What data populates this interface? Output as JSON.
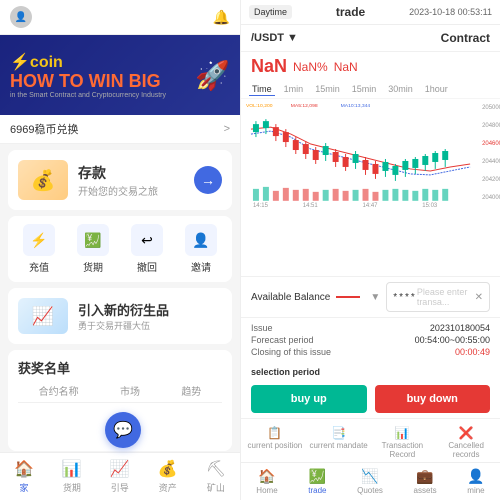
{
  "left": {
    "header": {
      "avatar_label": "👤",
      "notification_label": "🔔"
    },
    "banner": {
      "logo": "⚡coin",
      "tagline": "HOW TO WIN BIG",
      "sub": "in the Smart Contract and Cryptocurrency Industry"
    },
    "notice": {
      "text": "6969稳币兑换",
      "chevron": ">"
    },
    "deposit": {
      "title": "存款",
      "subtitle": "开始您的交易之旅",
      "btn_arrow": "→"
    },
    "actions": [
      {
        "icon": "⚡",
        "label": "充值"
      },
      {
        "icon": "💹",
        "label": "货期"
      },
      {
        "icon": "↩",
        "label": "撤回"
      },
      {
        "icon": "👤",
        "label": "邀请"
      }
    ],
    "promo": {
      "title": "引入新的衍生品",
      "subtitle": "勇于交易开疆大伍"
    },
    "winners": {
      "title": "获奖名单",
      "columns": [
        "合约名称",
        "市场",
        "趋势"
      ]
    },
    "bottom_nav": [
      {
        "icon": "🏠",
        "label": "家",
        "active": true
      },
      {
        "icon": "📊",
        "label": "货期",
        "active": false
      },
      {
        "icon": "📈",
        "label": "引导",
        "active": false
      },
      {
        "icon": "💰",
        "label": "资产",
        "active": false
      },
      {
        "icon": "⛏",
        "label": "矿山",
        "active": false
      }
    ]
  },
  "right": {
    "header": {
      "daytime": "Daytime",
      "title": "trade",
      "datetime": "2023-10-18 00:53:11"
    },
    "contract": {
      "pair": "/USDT ▼",
      "label": "Contract"
    },
    "price": {
      "value": "NaN",
      "pct": "NaN%",
      "change": "NaN"
    },
    "chart_tabs": [
      "Time",
      "1min",
      "15min",
      "15min",
      "30min",
      "1hour"
    ],
    "balance": {
      "label": "Available Balance",
      "stars": "****",
      "placeholder": "Please enter transa..."
    },
    "issue": {
      "label": "Issue",
      "value": "202310180054",
      "forecast_label": "Forecast period",
      "forecast_value": "00:54:00~00:55:00",
      "closing_label": "Closing of this issue",
      "closing_value": "00:00:49"
    },
    "selection": "selection period",
    "buttons": {
      "buy_up": "buy up",
      "buy_down": "buy down"
    },
    "record_tabs": [
      {
        "icon": "📋",
        "label": "current position",
        "active": false
      },
      {
        "icon": "📑",
        "label": "current mandate",
        "active": false
      },
      {
        "icon": "📊",
        "label": "Transaction Record",
        "active": false
      },
      {
        "icon": "❌",
        "label": "Cancelled records",
        "active": false
      }
    ],
    "bottom_nav": [
      {
        "icon": "🏠",
        "label": "Home",
        "active": false
      },
      {
        "icon": "💹",
        "label": "trade",
        "active": true
      },
      {
        "icon": "📉",
        "label": "Quotes",
        "active": false
      },
      {
        "icon": "💼",
        "label": "assets",
        "active": false
      },
      {
        "icon": "👤",
        "label": "mine",
        "active": false
      }
    ]
  }
}
